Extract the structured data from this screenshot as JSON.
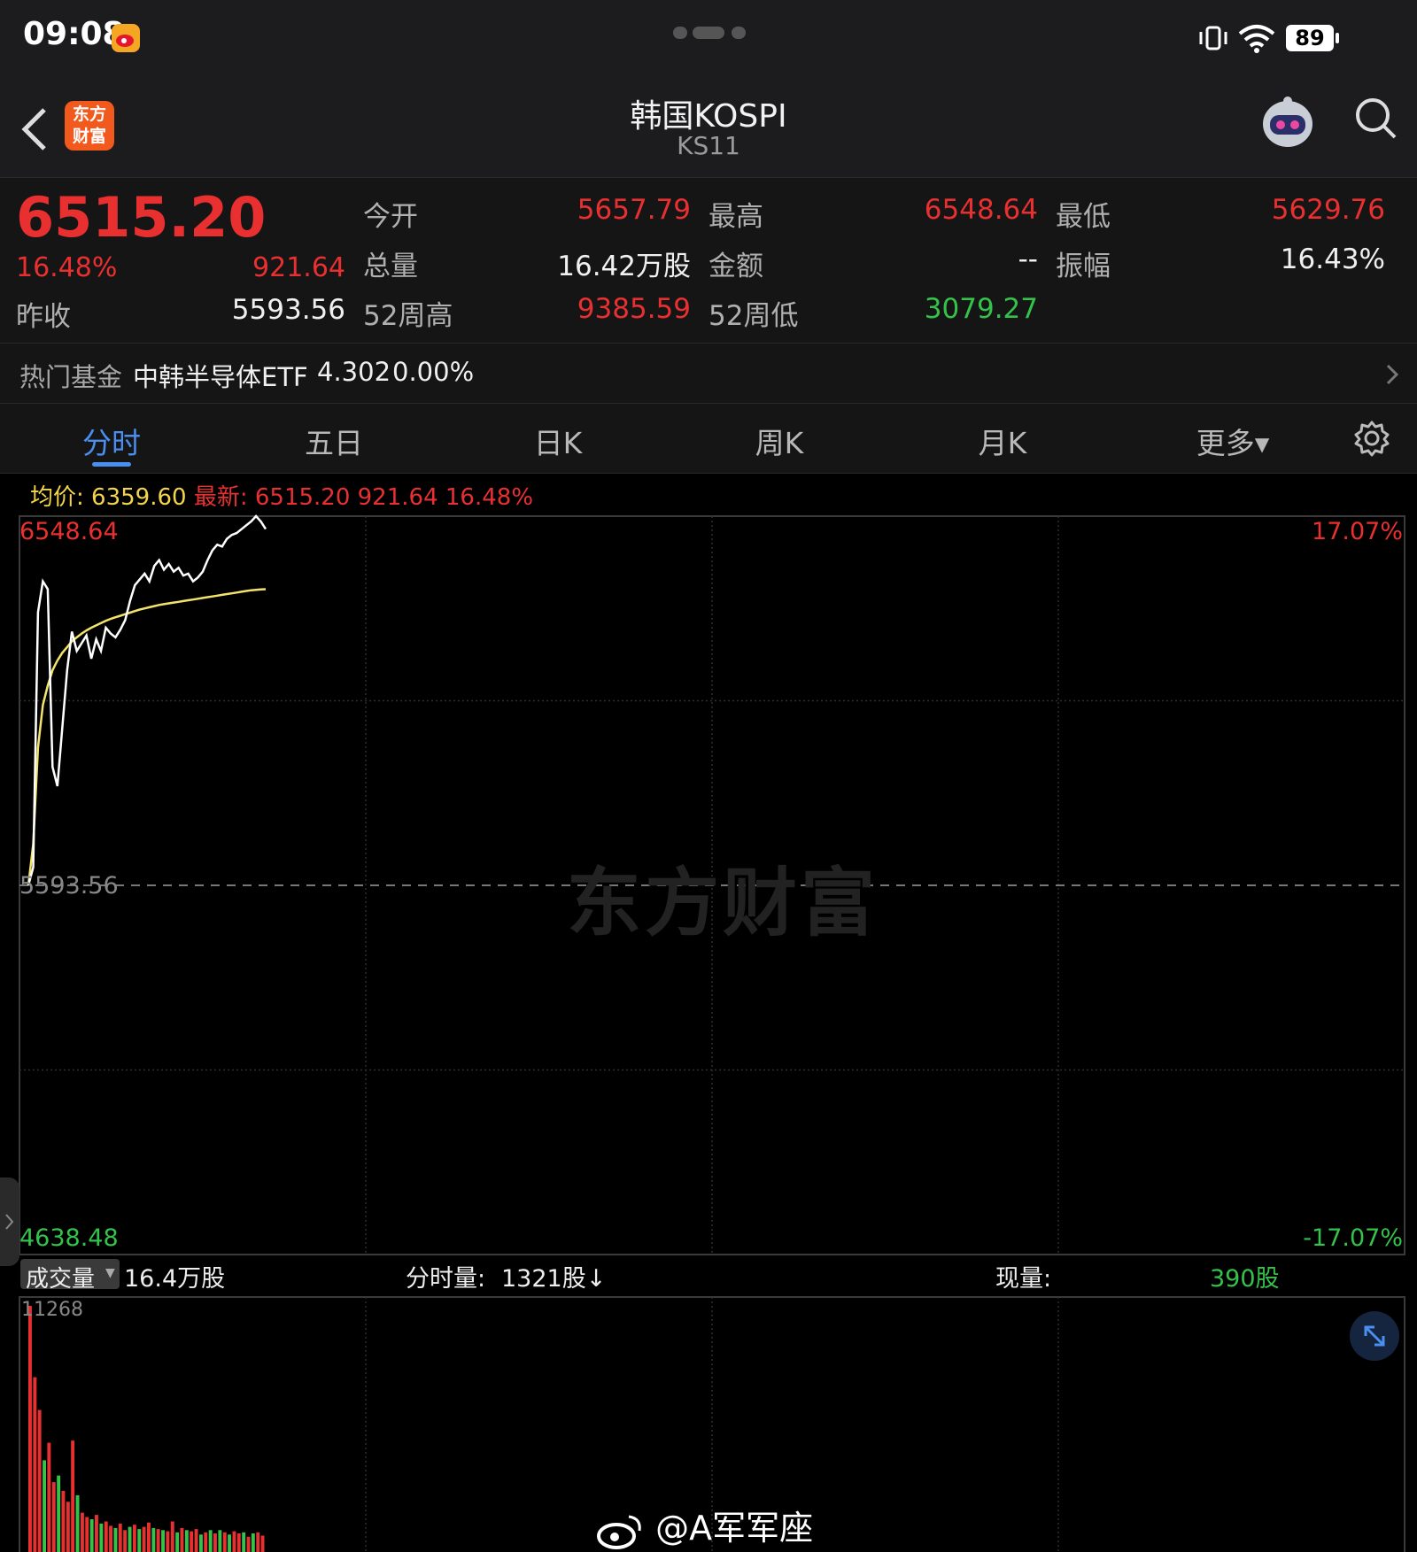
{
  "status": {
    "time": "09:08",
    "battery": "89"
  },
  "header": {
    "title": "韩国KOSPI",
    "code": "KS11",
    "logo_text_1": "东方",
    "logo_text_2": "财富"
  },
  "quote": {
    "price": "6515.20",
    "change_pct": "16.48%",
    "change": "921.64",
    "prev_close_label": "昨收",
    "prev_close": "5593.56",
    "open_label": "今开",
    "open": "5657.79",
    "high_label": "最高",
    "high": "6548.64",
    "low_label": "最低",
    "low": "5629.76",
    "volume_label": "总量",
    "volume": "16.42万股",
    "amount_label": "金额",
    "amount": "--",
    "amplitude_label": "振幅",
    "amplitude": "16.43%",
    "wk52_high_label": "52周高",
    "wk52_high": "9385.59",
    "wk52_low_label": "52周低",
    "wk52_low": "3079.27"
  },
  "fund": {
    "label": "热门基金",
    "name": "中韩半导体ETF",
    "price": "4.302",
    "change": "0.00%"
  },
  "tabs": [
    "分时",
    "五日",
    "日K",
    "周K",
    "月K",
    "更多▾"
  ],
  "chart_info": {
    "avg_label": "均价:",
    "avg": "6359.60",
    "latest_label": "最新:",
    "latest": "6515.20 921.64 16.48%"
  },
  "chart_axis": {
    "top_price": "6548.64",
    "mid_price": "5593.56",
    "bottom_price": "4638.48",
    "top_pct": "17.07%",
    "bottom_pct": "-17.07%"
  },
  "volume_bar": {
    "selector_label": "成交量",
    "total": "16.4万股",
    "minute_label": "分时量:",
    "minute_value": "1321股↓",
    "current_label": "现量:",
    "current_value": "390股",
    "axis_max": "11268"
  },
  "watermark": "东方财富",
  "credit": "@A军军座",
  "colors": {
    "up": "#e93030",
    "down": "#35c24a",
    "avg_line": "#f3e36a",
    "price_line": "#ffffff",
    "accent_tab": "#4a8ef0"
  },
  "chart_data": {
    "type": "line",
    "ylim": [
      4638.48,
      6548.64
    ],
    "reference": 5593.56,
    "price_series": [
      5593.56,
      5640,
      6300,
      6380,
      6360,
      5900,
      5850,
      6000,
      6150,
      6250,
      6200,
      6220,
      6240,
      6180,
      6230,
      6200,
      6260,
      6245,
      6235,
      6255,
      6280,
      6330,
      6370,
      6385,
      6400,
      6380,
      6420,
      6435,
      6410,
      6425,
      6405,
      6415,
      6395,
      6400,
      6380,
      6390,
      6405,
      6435,
      6460,
      6475,
      6470,
      6490,
      6500,
      6505,
      6515,
      6525,
      6535,
      6548.64,
      6535,
      6515.2
    ],
    "avg_series": [
      5593.56,
      5700,
      5950,
      6060,
      6110,
      6150,
      6175,
      6195,
      6210,
      6225,
      6235,
      6245,
      6253,
      6260,
      6266,
      6272,
      6278,
      6283,
      6287,
      6291,
      6295,
      6299,
      6303,
      6307,
      6310,
      6313,
      6316,
      6319,
      6321,
      6323,
      6325,
      6327,
      6329,
      6331,
      6333,
      6335,
      6337,
      6339,
      6341,
      6343,
      6345,
      6347,
      6349,
      6351,
      6353,
      6355,
      6357,
      6358,
      6359,
      6359.6
    ],
    "volume_max": 11268,
    "volume_series": [
      11268,
      8000,
      6500,
      4200,
      5000,
      3200,
      3500,
      2800,
      2300,
      5100,
      2600,
      1800,
      1600,
      1500,
      1700,
      1300,
      1400,
      1200,
      1100,
      1300,
      1000,
      1150,
      1250,
      1050,
      1150,
      1350,
      1100,
      1050,
      1000,
      950,
      1400,
      900,
      1100,
      1000,
      950,
      1050,
      800,
      900,
      1000,
      850,
      1000,
      900,
      800,
      950,
      850,
      900,
      700,
      850,
      900,
      750
    ],
    "volume_colors": [
      "r",
      "r",
      "r",
      "g",
      "r",
      "r",
      "g",
      "r",
      "r",
      "r",
      "g",
      "r",
      "r",
      "g",
      "r",
      "g",
      "r",
      "r",
      "g",
      "r",
      "r",
      "g",
      "r",
      "g",
      "r",
      "r",
      "g",
      "r",
      "g",
      "r",
      "r",
      "g",
      "r",
      "g",
      "r",
      "r",
      "g",
      "r",
      "g",
      "r",
      "g",
      "r",
      "g",
      "r",
      "r",
      "g",
      "r",
      "g",
      "r",
      "r"
    ]
  }
}
